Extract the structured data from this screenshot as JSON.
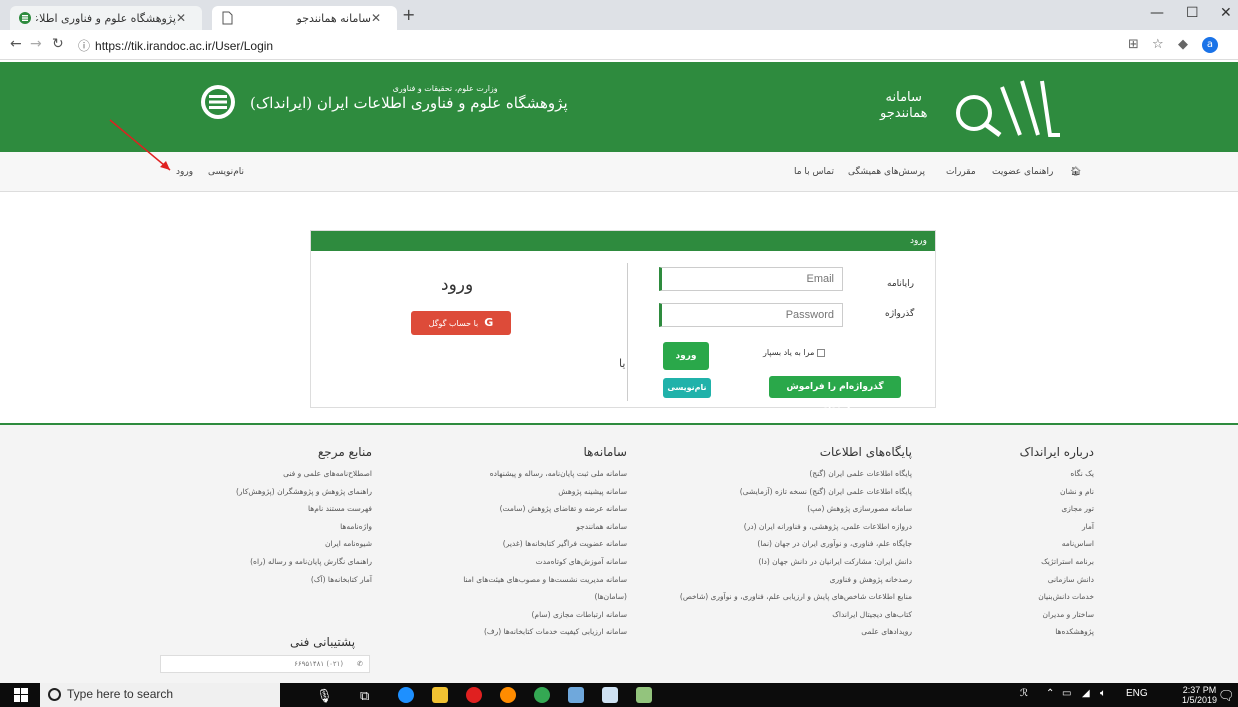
{
  "browser": {
    "tabs": [
      {
        "title": "پژوهشگاه علوم و فناوری اطلاعات ایران"
      },
      {
        "title": "سامانه همانندجو"
      }
    ],
    "url": "https://tik.irandoc.ac.ir/User/Login",
    "profile_initial": "a"
  },
  "banner": {
    "site_title_line1": "سامانه",
    "site_title_line2": "همانندجو",
    "org_small": "وزارت علوم، تحقیقات و فناوری",
    "org_name": "پژوهشگاه علوم و فناوری اطلاعات ایران (ایرانداک)"
  },
  "nav": {
    "home_icon": "home-icon",
    "membership_guide": "راهنمای عضویت",
    "rules": "مقررات",
    "faq": "پرسش‌های همیشگی",
    "contact": "تماس با ما",
    "register": "نام‌نویسی",
    "login": "ورود"
  },
  "login": {
    "header": "ورود",
    "title": "ورود",
    "email_label": "رایانامه",
    "email_placeholder": "Email",
    "password_label": "گذرواژه",
    "password_placeholder": "Password",
    "remember": "مرا به یاد بسپار",
    "submit": "ورود",
    "forgot": "گذرواژه‌ام را فراموش کرده‌ام.",
    "register": "نام‌نویسی",
    "or": "یا",
    "google": "با حساب گوگل"
  },
  "footer": {
    "about": {
      "title": "درباره ایرانداک",
      "items": [
        "یک نگاه",
        "نام و نشان",
        "تور مجازی",
        "آمار",
        "اساس‌نامه",
        "برنامه استراتژیک",
        "دانش سازمانی",
        "خدمات دانش‌بنیان",
        "ساختار و مدیران",
        "پژوهشکده‌ها"
      ]
    },
    "databases": {
      "title": "پایگاه‌های اطلاعات",
      "items": [
        "پایگاه اطلاعات علمی ایران (گنج)",
        "پایگاه اطلاعات علمی ایران (گنج) نسخه تازه (آزمایشی)",
        "سامانه مصورسازی پژوهش (مپ)",
        "دروازه اطلاعات علمی، پژوهشی، و فناورانه ایران (در)",
        "جایگاه علم، فناوری، و نوآوری ایران در جهان (نما)",
        "دانش ایران: مشارکت ایرانیان در دانش جهان (دا)",
        "رصدخانه پژوهش و فناوری",
        "منابع اطلاعات شاخص‌های پایش و ارزیابی علم، فناوری، و نوآوری (شاخص)",
        "کتاب‌های دیجیتال ایرانداک",
        "رویدادهای علمی"
      ]
    },
    "systems": {
      "title": "سامانه‌ها",
      "items": [
        "سامانه ملی ثبت پایان‌نامه، رساله و پیشنهاده",
        "سامانه پیشینه پژوهش",
        "سامانه عرضه و تقاضای پژوهش (سامت)",
        "سامانه همانندجو",
        "سامانه عضویت فراگیر کتابخانه‌ها (غدیر)",
        "سامانه آموزش‌های کوتاه‌مدت",
        "سامانه مدیریت نشست‌ها و مصوب‌های هیئت‌های امنا",
        "(سامان‌ها)",
        "سامانه ارتباطات مجازی (سام)",
        "سامانه ارزیابی کیفیت خدمات کتابخانه‌ها (رف)"
      ]
    },
    "references": {
      "title": "منابع مرجع",
      "items": [
        "اصطلاح‌نامه‌های علمی و فنی",
        "راهنمای پژوهش و پژوهشگران (پژوهش‌کار)",
        "فهرست مستند نام‌ها",
        "واژه‌نامه‌ها",
        "شیوه‌نامه ایران",
        "راهنمای نگارش پایان‌نامه و رساله (راه)",
        "آمار کتابخانه‌ها (آک)"
      ]
    },
    "support_title": "پشتیبانی فنی",
    "phone": "(۰۲۱) ۶۶۹۵۱۴۸۱"
  },
  "taskbar": {
    "search_placeholder": "Type here to search",
    "lang": "ENG",
    "time": "2:37 PM",
    "date": "1/5/2019"
  },
  "colors": {
    "brand_green": "#2e8b3e",
    "button_green": "#2aa84a",
    "teal": "#20b2aa",
    "google_red": "#dd4b39",
    "annotation_arrow": "#e02020"
  }
}
